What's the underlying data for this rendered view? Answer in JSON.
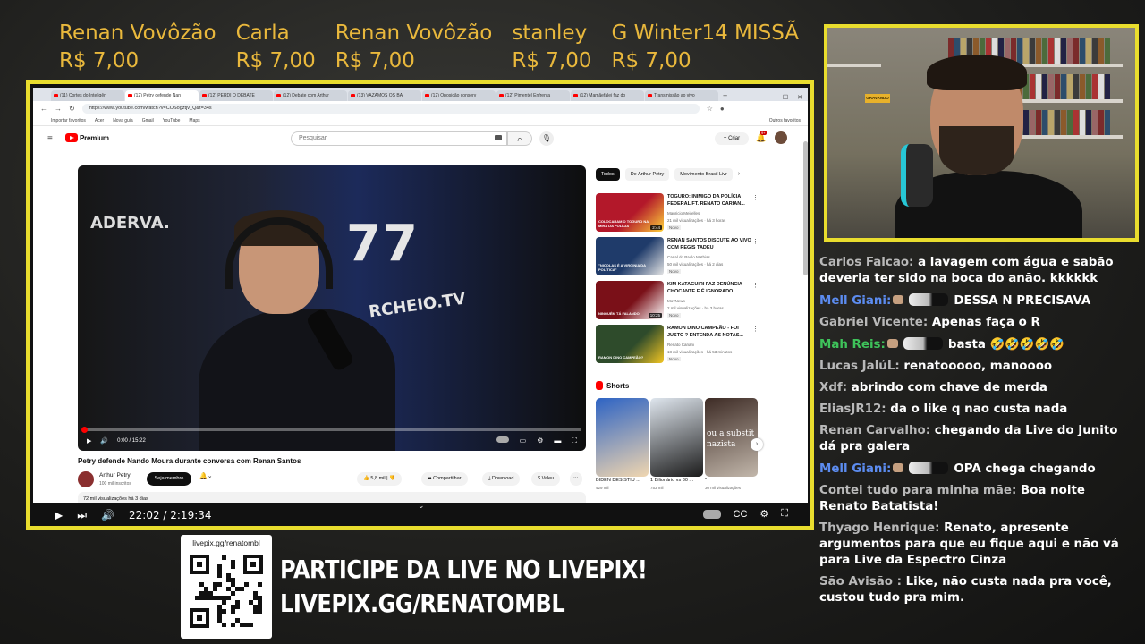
{
  "donations": [
    {
      "name": "Renan Vovôzão",
      "value": "R$ 7,00"
    },
    {
      "name": "Carla",
      "value": "R$ 7,00"
    },
    {
      "name": "Renan Vovôzão",
      "value": "R$ 7,00"
    },
    {
      "name": "stanley",
      "value": "R$ 7,00"
    },
    {
      "name": "G Winter14 MISSÃ",
      "value": "R$ 7,00"
    }
  ],
  "browser": {
    "tabs": [
      "(11) Cortes do Inteligên",
      "(12) Petry defende Nan",
      "(12) PERDI O DEBATE",
      "(12) Debate com Arthur",
      "(13) VAZAMOS OS BA",
      "(12) Oposição conserv",
      "(12) Pimentel Enfrenta",
      "(12) Mamãefalei faz do",
      "Transmissão ao vivo"
    ],
    "url": "https://www.youtube.com/watch?v=COSogztjv_Q&t=34s",
    "bookmarks": [
      "Importar favoritos",
      "Acer",
      "Nova guia",
      "Gmail",
      "YouTube",
      "Maps"
    ],
    "bookmarks_right": "Outros favoritos"
  },
  "youtube": {
    "logo_text": "Premium",
    "search_placeholder": "Pesquisar",
    "create_label": "+ Criar",
    "notif_count": "9+",
    "video": {
      "time": "0:00 / 15:22",
      "progress_fraction": 0.001,
      "title": "Petry defende Nando Moura durante conversa com Renan Santos",
      "channel": "Arthur Petry",
      "subs": "100 mil inscritos",
      "join_label": "Seja membro",
      "likes": "5,8 mil",
      "share_label": "Compartilhar",
      "download_label": "Download",
      "thanks_label": "Valeu",
      "stats": "72 mil visualizações  há 3 dias",
      "shirt_text": "ADERVA.",
      "shirt_number": "77",
      "shirt_site": "RCHEIO.TV"
    },
    "chips": [
      "Todos",
      "De Arthur Petry",
      "Movimento Brasil Livr"
    ],
    "recommendations": [
      {
        "title": "TOGURO: INIMIGO DA POLÍCIA FEDERAL FT. RENATO CARIAN...",
        "channel": "Mauricio Meirelles",
        "stats": "21 mil visualizações · há 3 horas",
        "badge": "Novo",
        "duration": "2:44",
        "thumb_text": "COLOCARAM O TOGURO NA MIRA DA POLÍCIA",
        "color1": "#b3182a",
        "color2": "#ffd23a"
      },
      {
        "title": "RENAN SANTOS DISCUTE AO VIVO COM REGIS TADEU",
        "channel": "Canal do Paulo Mathias",
        "stats": "50 mil visualizações · há 2 dias",
        "badge": "Novo",
        "duration": "",
        "thumb_text": "\"NICOLAS É A VIRGINIA DA POLÍTICA\"",
        "color1": "#1f3b6a",
        "color2": "#e5e5e5"
      },
      {
        "title": "KIM KATAGUIRI FAZ DENÚNCIA CHOCANTE E É IGNORADO ...",
        "channel": "MovNews",
        "stats": "2 mil visualizações · há 3 horas",
        "badge": "Novo",
        "duration": "10:25",
        "thumb_text": "NINGUÉM TÁ FALANDO",
        "color1": "#7a1018",
        "color2": "#ffffff"
      },
      {
        "title": "RAMON DINO CAMPEÃO - FOI JUSTO ? ENTENDA AS NOTAS...",
        "channel": "Renato Cariani",
        "stats": "18 mil visualizações · há 53 minutos",
        "badge": "Novo",
        "duration": "",
        "thumb_text": "RAMON DINO CAMPEÃO?",
        "color1": "#2e4b2b",
        "color2": "#f3c623"
      }
    ],
    "shorts_label": "Shorts",
    "shorts": [
      {
        "title": "BIDEN DESISTIU ...",
        "views": "429 mil",
        "color1": "#2d63c4",
        "color2": "#f0d6b0",
        "overlay": ""
      },
      {
        "title": "1 Bilionário vs 30 ...",
        "views": "753 mil",
        "color1": "#dfe6ee",
        "color2": "#1b1b1b",
        "overlay": ""
      },
      {
        "title": "\"",
        "views": "30 mil visualizações",
        "color1": "#3d2b25",
        "color2": "#c2b7ab",
        "overlay": "ou a substit nazista"
      }
    ]
  },
  "outer_player": {
    "time": "22:02 / 2:19:34"
  },
  "chat": [
    {
      "user": "Carlos Falcao:",
      "text": "a lavagem com água e sabão deveria ter sido na boca do anão. kkkkkk",
      "user_color": "#b9b9b9",
      "badges": false
    },
    {
      "user": "Mell Giani:",
      "text": "DESSA N PRECISAVA",
      "user_color": "#5c8cf0",
      "badges": true
    },
    {
      "user": "Gabriel Vicente:",
      "text": "Apenas faça o R",
      "user_color": "#b9b9b9",
      "badges": false
    },
    {
      "user": "Mah Reis:",
      "text": "basta 🤣🤣🤣🤣🤣",
      "user_color": "#3ec25a",
      "badges": true
    },
    {
      "user": "Lucas JalúL:",
      "text": "renatooooo, manoooo",
      "user_color": "#b9b9b9",
      "badges": false
    },
    {
      "user": "Xdf:",
      "text": "abrindo com chave de merda",
      "user_color": "#b9b9b9",
      "badges": false
    },
    {
      "user": "EliasJR12:",
      "text": "da o like q nao custa nada",
      "user_color": "#b9b9b9",
      "badges": false
    },
    {
      "user": "Renan Carvalho:",
      "text": "chegando da Live do Junito dá pra galera",
      "user_color": "#b9b9b9",
      "badges": false
    },
    {
      "user": "Mell Giani:",
      "text": "OPA chega chegando",
      "user_color": "#5c8cf0",
      "badges": true
    },
    {
      "user": "Contei tudo para minha mãe:",
      "text": "Boa noite Renato Batatista!",
      "user_color": "#b9b9b9",
      "badges": false
    },
    {
      "user": "Thyago Henrique:",
      "text": "Renato, apresente argumentos para que eu fique aqui e não vá para Live da Espectro Cinza",
      "user_color": "#b9b9b9",
      "badges": false
    },
    {
      "user": "São Avisão :",
      "text": "Like, não custa nada pra você, custou tudo pra mim.",
      "user_color": "#b9b9b9",
      "badges": false
    }
  ],
  "livepix": {
    "qr_label": "livepix.gg/renatombl",
    "headline": "PARTICIPE DA LIVE NO LIVEPIX!",
    "url_text": "LIVEPIX.GG/RENATOMBL"
  },
  "webcam": {
    "sign_text": "GRAVANDO"
  },
  "colors": {
    "frame": "#e9dd2e",
    "donation": "#e9b83c",
    "yt_red": "#ff0000"
  }
}
